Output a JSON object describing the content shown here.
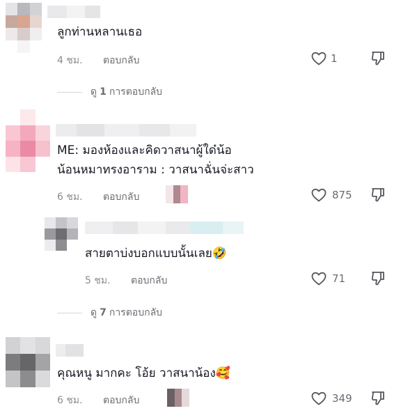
{
  "comments": [
    {
      "text": "ลูกท่านหลานเธอ",
      "time": "4 ชม.",
      "reply_label": "ตอบกลับ",
      "likes": "1",
      "view_replies": {
        "prefix": "ดู",
        "count": "1",
        "suffix": "การตอบกลับ"
      }
    },
    {
      "text_line1": "ME: มองห้องและคิดวาสนาผู้ใด๋น้อ",
      "text_line2": "น้อนหมาทรงอาราม : วาสนาฉั่นจ่ะสาว",
      "time": "6 ชม.",
      "reply_label": "ตอบกลับ",
      "likes": "875"
    },
    {
      "text": "สายตาบ่งบอกแบบนั้นเลย🤣",
      "time": "5 ชม.",
      "reply_label": "ตอบกลับ",
      "likes": "71",
      "view_replies": {
        "prefix": "ดู",
        "count": "7",
        "suffix": "การตอบกลับ"
      }
    },
    {
      "text": "คุณหนู มากคะ โอ้ย วาสนาน้อง🥰",
      "time": "6 ชม.",
      "reply_label": "ตอบกลับ",
      "likes": "349"
    }
  ],
  "icons": {
    "like": "heart-outline-icon",
    "dislike": "thumbs-down-icon"
  }
}
